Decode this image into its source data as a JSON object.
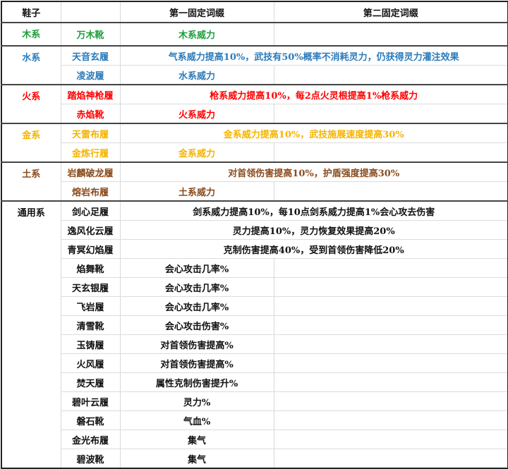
{
  "header": {
    "col1": "鞋子",
    "col2": "",
    "col3": "第一固定词缀",
    "col4": "第二固定词缀"
  },
  "colors": {
    "wood": "#1e9e3c",
    "water": "#2b7bbb",
    "fire": "#ff0000",
    "metal": "#f5b400",
    "earth": "#8a4a1c",
    "general": "#111111"
  },
  "groups": [
    {
      "label": "木系",
      "color": "wood",
      "rows": [
        {
          "name": "万木靴",
          "effect": "木系威力",
          "span": false
        }
      ]
    },
    {
      "label": "水系",
      "color": "water",
      "rows": [
        {
          "name": "天音玄履",
          "effect": "气系威力提高10%，武技有50%概率不消耗灵力，仍获得灵力灌注效果",
          "span": true
        },
        {
          "name": "凌波履",
          "effect": "水系威力",
          "span": false
        }
      ]
    },
    {
      "label": "火系",
      "color": "fire",
      "rows": [
        {
          "name": "踏焰神枪履",
          "effect": "枪系威力提高10%，每2点火灵根提高1%枪系威力",
          "span": true
        },
        {
          "name": "赤焰靴",
          "effect": "火系威力",
          "span": false
        }
      ]
    },
    {
      "label": "金系",
      "color": "metal",
      "rows": [
        {
          "name": "天雷布履",
          "effect": "金系威力提高10%，武技施展速度提高30%",
          "span": true
        },
        {
          "name": "金炼行履",
          "effect": "金系威力",
          "span": false
        }
      ]
    },
    {
      "label": "土系",
      "color": "earth",
      "rows": [
        {
          "name": "岩麟破龙履",
          "effect": "对首领伤害提高10%，护盾强度提高30%",
          "span": true
        },
        {
          "name": "熔岩布履",
          "effect": "土系威力",
          "span": false
        }
      ]
    },
    {
      "label": "通用系",
      "color": "general",
      "rows": [
        {
          "name": "剑心足履",
          "effect": "剑系威力提高10%，每10点剑系威力提高1%会心攻去伤害",
          "span": true
        },
        {
          "name": "逸风化云履",
          "effect": "灵力提高10%，灵力恢复效果提高20%",
          "span": true
        },
        {
          "name": "青冥幻焰履",
          "effect": "克制伤害提高40%，受到首领伤害降低20%",
          "span": true
        },
        {
          "name": "焰舞靴",
          "effect": "会心攻击几率%",
          "span": false
        },
        {
          "name": "天玄银履",
          "effect": "会心攻击几率%",
          "span": false
        },
        {
          "name": "飞岩履",
          "effect": "会心攻击几率%",
          "span": false
        },
        {
          "name": "清雪靴",
          "effect": "会心攻击伤害%",
          "span": false
        },
        {
          "name": "玉铸履",
          "effect": "对首领伤害提高%",
          "span": false
        },
        {
          "name": "火风履",
          "effect": "对首领伤害提高%",
          "span": false
        },
        {
          "name": "焚天履",
          "effect": "属性克制伤害提升%",
          "span": false
        },
        {
          "name": "碧叶云履",
          "effect": "灵力%",
          "span": false
        },
        {
          "name": "磐石靴",
          "effect": "气血%",
          "span": false
        },
        {
          "name": "金光布履",
          "effect": "集气",
          "span": false
        },
        {
          "name": "碧波靴",
          "effect": "集气",
          "span": false
        }
      ]
    }
  ]
}
